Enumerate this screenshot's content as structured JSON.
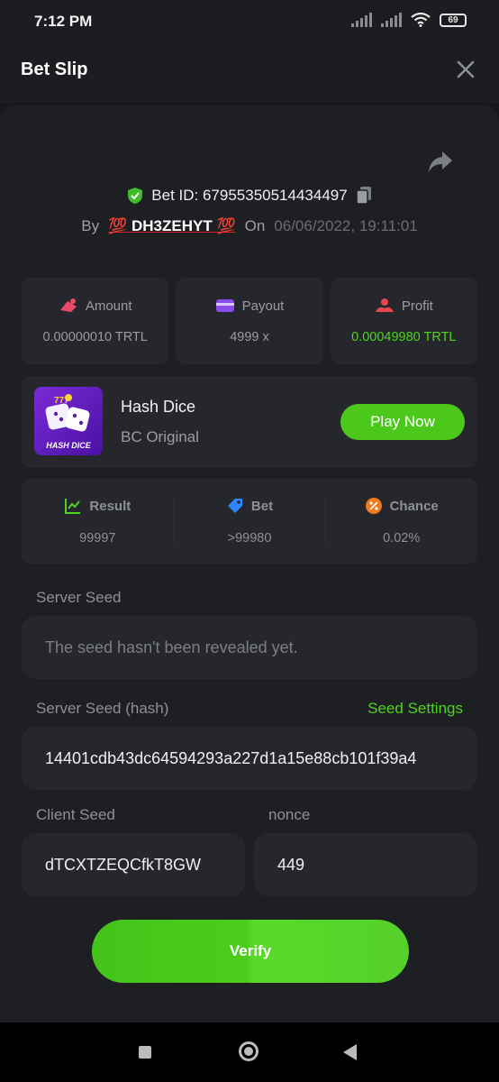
{
  "status_bar": {
    "time": "7:12 PM",
    "battery": "69"
  },
  "header": {
    "title": "Bet Slip"
  },
  "bet": {
    "id_text": "Bet ID: 67955350514434497",
    "by_label": "By",
    "user": "💯 DH3ZEHYT 💯",
    "on_label": "On",
    "date": "06/06/2022, 19:11:01"
  },
  "stats": [
    {
      "label": "Amount",
      "value": "0.00000010 TRTL"
    },
    {
      "label": "Payout",
      "value": "4999 x"
    },
    {
      "label": "Profit",
      "value": "0.00049980 TRTL"
    }
  ],
  "game": {
    "name": "Hash Dice",
    "sub": "BC Original",
    "thumb_label": "HASH DICE",
    "play_label": "Play Now"
  },
  "results": [
    {
      "label": "Result",
      "value": "99997"
    },
    {
      "label": "Bet",
      "value": ">99980"
    },
    {
      "label": "Chance",
      "value": "0.02%"
    }
  ],
  "server_seed": {
    "label": "Server Seed",
    "value": "The seed hasn't been revealed yet."
  },
  "server_seed_hash": {
    "label": "Server Seed (hash)",
    "link": "Seed Settings",
    "value": "14401cdb43dc64594293a227d1a15e88cb101f39a4"
  },
  "client_seed": {
    "label": "Client Seed",
    "value": "dTCXTZEQCfkT8GW"
  },
  "nonce": {
    "label": "nonce",
    "value": "449"
  },
  "verify_label": "Verify",
  "colors": {
    "accent_green": "#4cc81c",
    "bg": "#1e1f23",
    "panel": "#26272c"
  }
}
